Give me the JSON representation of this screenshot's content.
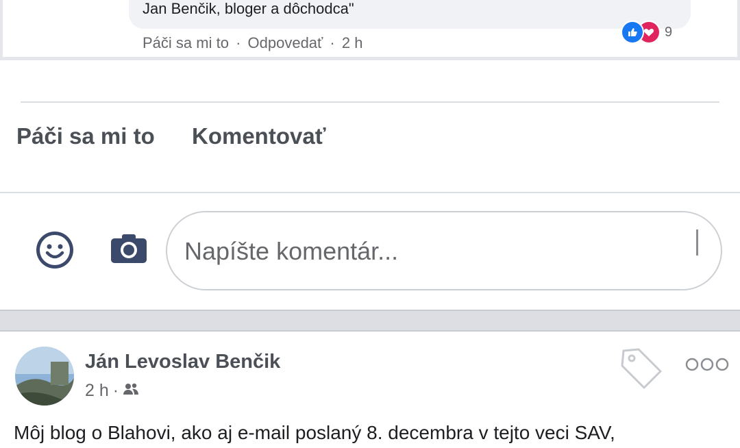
{
  "comment": {
    "text": "Jan Benčik, bloger a dôchodca\"",
    "like_action": "Páči sa mi to",
    "separator": "·",
    "reply_action": "Odpovedať",
    "time": "2 h",
    "reaction_count": "9",
    "reactions": [
      "like-icon",
      "love-icon"
    ]
  },
  "post_actions": {
    "like_label": "Páči sa mi to",
    "comment_label": "Komentovať"
  },
  "composer": {
    "placeholder": "Napíšte komentár..."
  },
  "next_post": {
    "author": "Ján Levoslav Benčik",
    "time": "2 h",
    "separator": "·",
    "audience_icon": "friends-icon",
    "text": "Môj blog o Blahovi, ako aj e-mail poslaný 8. decembra v tejto veci SAV,"
  },
  "colors": {
    "like_blue": "#1877f2",
    "love_red": "#e0245e",
    "icon_navy": "#3b4a6b"
  }
}
